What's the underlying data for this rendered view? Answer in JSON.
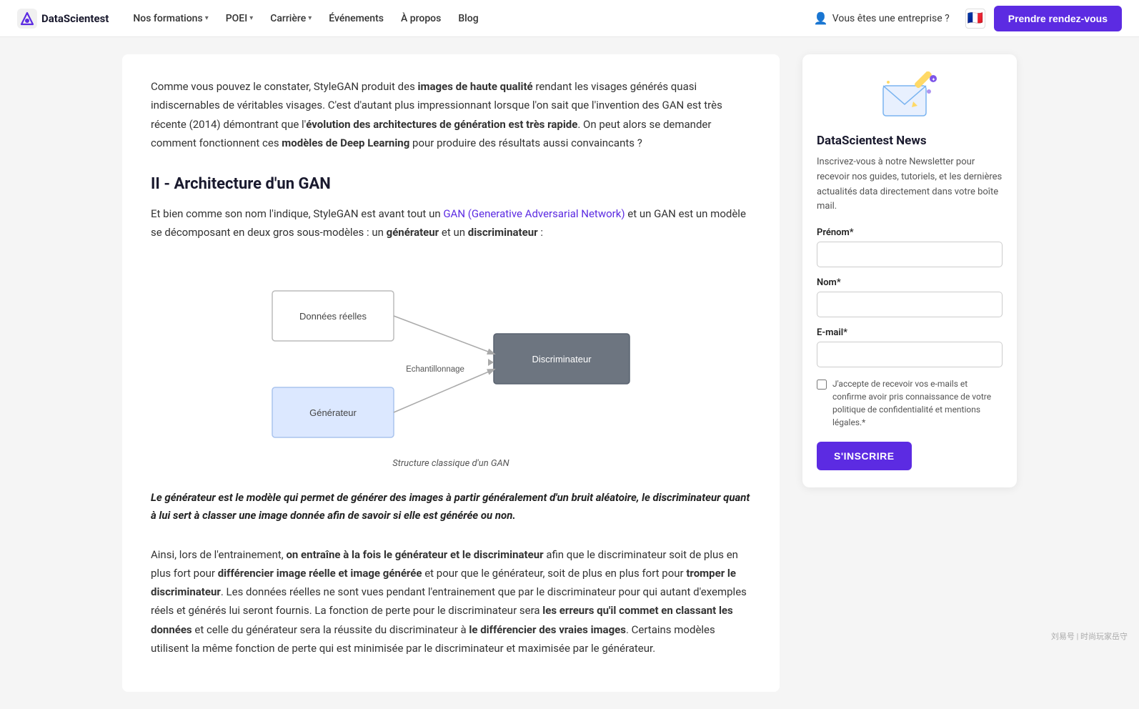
{
  "navbar": {
    "logo_text": "DataScientest",
    "nav_items": [
      {
        "label": "Nos formations",
        "has_dropdown": true
      },
      {
        "label": "POEI",
        "has_dropdown": true
      },
      {
        "label": "Carrière",
        "has_dropdown": true
      },
      {
        "label": "Événements",
        "has_dropdown": false
      },
      {
        "label": "À propos",
        "has_dropdown": false
      },
      {
        "label": "Blog",
        "has_dropdown": false
      }
    ],
    "enterprise_label": "Vous êtes une entreprise ?",
    "cta_label": "Prendre rendez-vous",
    "flag_emoji": "🇫🇷"
  },
  "article": {
    "intro_text_1": "Comme vous pouvez le constater, StyleGAN produit des ",
    "intro_bold_1": "images de haute qualité",
    "intro_text_2": " rendant les visages générés quasi indiscernables de véritables visages. C'est d'autant plus impressionnant lorsque l'on sait que l'invention des GAN est très récente (2014) démontrant que l'",
    "intro_bold_2": "évolution des architectures de génération est très rapide",
    "intro_text_3": ". On peut alors se demander comment fonctionnent ces ",
    "intro_bold_3": "modèles de Deep Learning",
    "intro_text_4": " pour produire des résultats aussi convaincants ?",
    "section_title": "II - Architecture d'un GAN",
    "section_intro_1": "Et bien comme son nom l'indique, StyleGAN est avant tout un ",
    "section_link": "GAN (Generative Adversarial Network)",
    "section_intro_2": " et un GAN est un modèle se décomposant en deux gros sous-modèles : un ",
    "section_bold_1": "générateur",
    "section_intro_3": " et un ",
    "section_bold_2": "discriminateur",
    "section_intro_4": " :",
    "diagram_caption": "Structure classique d'un GAN",
    "diagram": {
      "node_donnees": "Données réelles",
      "node_generateur": "Générateur",
      "node_discriminateur": "Discriminateur",
      "edge_label": "Echantillonnage"
    },
    "blockquote": "Le générateur est le modèle qui permet de générer des images à partir généralement d'un bruit aléatoire, le discriminateur quant à lui sert à classer une image donnée afin de savoir si elle est générée ou non.",
    "final_para_1": "Ainsi, lors de l'entrainement, ",
    "final_bold_1": "on entraîne à la fois le générateur et le discriminateur",
    "final_text_2": " afin que le discriminateur soit de plus en plus fort pour ",
    "final_bold_2": "différencier image réelle et image générée",
    "final_text_3": " et pour que le générateur, soit de plus en plus fort pour ",
    "final_bold_3": "tromper le discriminateur",
    "final_text_4": ". Les données réelles ne sont vues pendant l'entrainement que par le discriminateur pour qui autant d'exemples réels et générés lui seront fournis. La fonction de perte pour le discriminateur sera ",
    "final_bold_4": "les erreurs qu'il commet en classant les données",
    "final_text_5": " et celle du générateur sera la réussite du discriminateur à ",
    "final_bold_5": "le différencier des vraies images",
    "final_text_6": ". Certains modèles utilisent la même fonction de perte qui est minimisée par le discriminateur et maximisée par le générateur."
  },
  "sidebar": {
    "newsletter_title": "DataScientest News",
    "newsletter_desc": "Inscrivez-vous à notre Newsletter pour recevoir nos guides, tutoriels, et les dernières actualités data directement dans votre boîte mail.",
    "label_prenom": "Prénom*",
    "label_nom": "Nom*",
    "label_email": "E-mail*",
    "placeholder_prenom": "",
    "placeholder_nom": "",
    "placeholder_email": "",
    "checkbox_label": "J'accepte de recevoir vos e-mails et confirme avoir pris connaissance de votre politique de confidentialité et mentions légales.*",
    "subscribe_btn": "S'INSCRIRE"
  },
  "watermark": "刘易号 | 时尚玩家岳守"
}
